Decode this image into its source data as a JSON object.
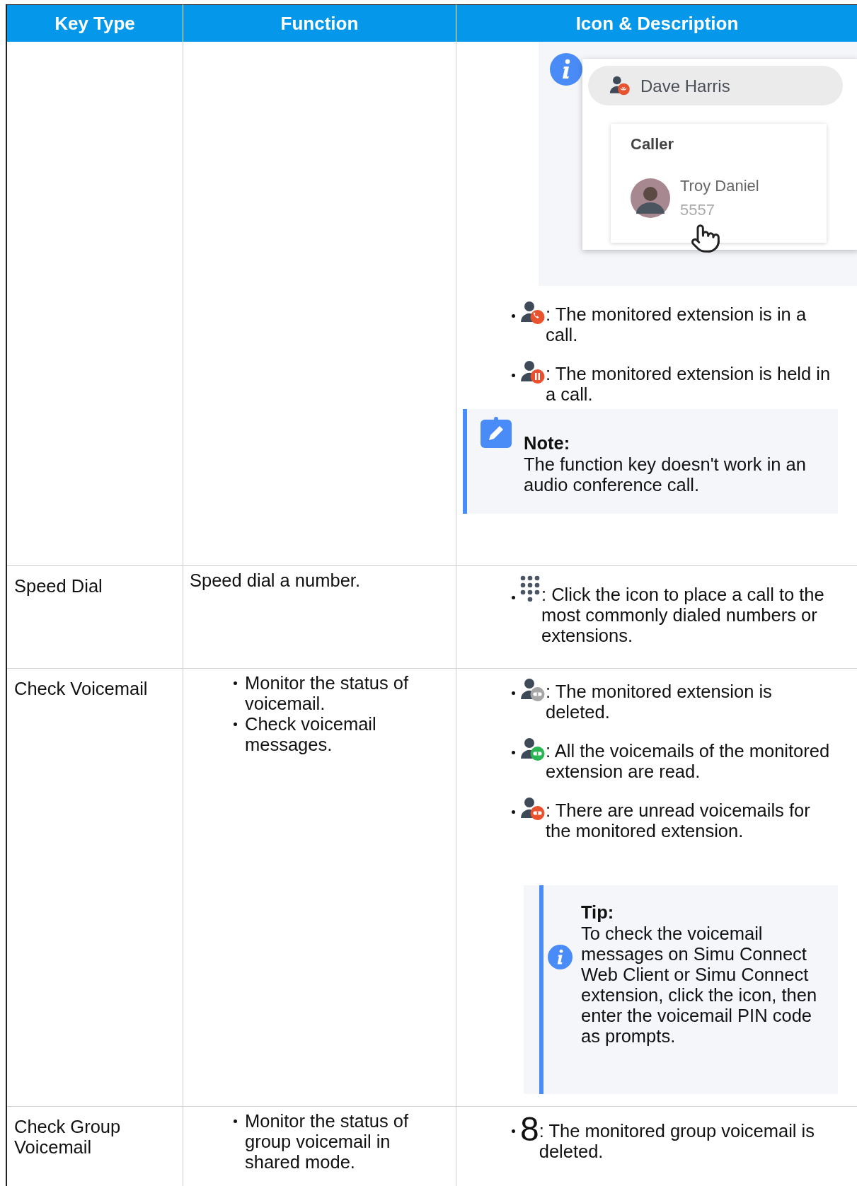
{
  "table": {
    "columns": [
      "Key Type",
      "Function",
      "Icon & Description"
    ],
    "rows": [
      {
        "description": [
          {
            "kind": "screenshot",
            "contact": "Dave Harris",
            "section": "Caller",
            "caller_name": "Troy Daniel",
            "caller_number": "5557"
          },
          {
            "kind": "in-call",
            "color": "#e8522f",
            "text": ": The monitored extension is in a call."
          },
          {
            "kind": "on-hold",
            "color": "#e8522f",
            "text": ": The monitored extension is held in a call."
          },
          {
            "kind": "note",
            "title": "Note:",
            "text": "The function key doesn't work in an audio conference call."
          }
        ]
      },
      {
        "key_type": "Speed Dial",
        "function_text": "Speed dial a number.",
        "description": [
          {
            "kind": "dialpad",
            "text": ": Click the icon to place a call to the most commonly dialed numbers or extensions."
          }
        ]
      },
      {
        "key_type": "Check Voicemail",
        "function_items": [
          "Monitor the status of voicemail.",
          "Check voicemail messages."
        ],
        "description": [
          {
            "kind": "voicemail",
            "color": "#a6a6a6",
            "text": ": The monitored extension is deleted."
          },
          {
            "kind": "voicemail",
            "color": "#2bb656",
            "text": ": All the voicemails of the monitored extension are read."
          },
          {
            "kind": "voicemail",
            "color": "#e8522f",
            "text": ": There are unread voicemails for the monitored extension."
          },
          {
            "kind": "tip",
            "title": "Tip:",
            "text": "To check the voicemail messages on Simu Connect Web  Client or Simu Connect extension, click the icon, then enter the voicemail PIN code as prompts."
          }
        ]
      },
      {
        "key_type": "Check Group Voicemail",
        "function_items": [
          "Monitor the status of group voicemail in shared mode."
        ],
        "description": [
          {
            "kind": "glyph",
            "glyph": "8",
            "text": ": The monitored group voicemail is deleted."
          }
        ]
      }
    ]
  }
}
